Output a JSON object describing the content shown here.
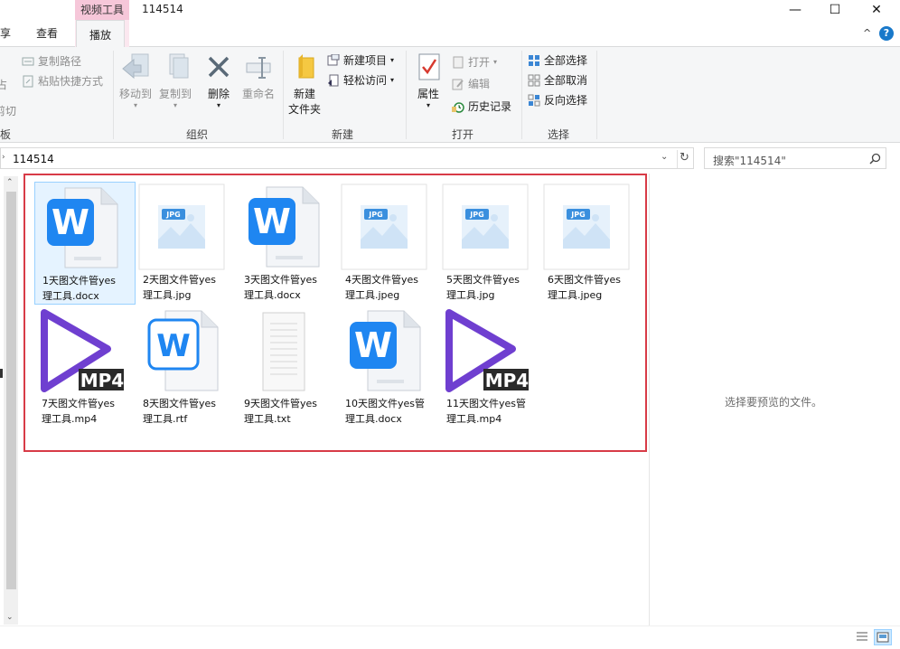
{
  "titlebar": {
    "context_tab": "视频工具",
    "title": "114514",
    "minimize": "—",
    "maximize": "☐",
    "close": "✕"
  },
  "tabs": {
    "share_partial": "享",
    "view": "查看",
    "play": "播放",
    "expand": "^",
    "help": "?"
  },
  "ribbon": {
    "clipboard": {
      "copy_path": "复制路径",
      "paste_shortcut": "粘贴快捷方式",
      "cut_partial": "剪切",
      "paste_partial_top": "占",
      "label_partial": "板"
    },
    "organize": {
      "move_to": "移动到",
      "copy_to": "复制到",
      "delete": "删除",
      "rename": "重命名",
      "label": "组织"
    },
    "new": {
      "new_folder_line1": "新建",
      "new_folder_line2": "文件夹",
      "new_item": "新建项目",
      "easy_access": "轻松访问",
      "label": "新建"
    },
    "open": {
      "properties": "属性",
      "open": "打开",
      "edit": "编辑",
      "history": "历史记录",
      "label": "打开"
    },
    "select": {
      "select_all": "全部选择",
      "select_none": "全部取消",
      "invert": "反向选择",
      "label": "选择"
    }
  },
  "address": {
    "path": "114514",
    "search_placeholder": "搜索\"114514\""
  },
  "files": [
    {
      "line1": "1天图文件管yes",
      "line2": "理工具.docx",
      "type": "word"
    },
    {
      "line1": "2天图文件管yes",
      "line2": "理工具.jpg",
      "type": "jpg"
    },
    {
      "line1": "3天图文件管yes",
      "line2": "理工具.docx",
      "type": "word"
    },
    {
      "line1": "4天图文件管yes",
      "line2": "理工具.jpeg",
      "type": "jpg"
    },
    {
      "line1": "5天图文件管yes",
      "line2": "理工具.jpg",
      "type": "jpg"
    },
    {
      "line1": "6天图文件管yes",
      "line2": "理工具.jpeg",
      "type": "jpg"
    },
    {
      "line1": "7天图文件管yes",
      "line2": "理工具.mp4",
      "type": "mp4"
    },
    {
      "line1": "8天图文件管yes",
      "line2": "理工具.rtf",
      "type": "rtf"
    },
    {
      "line1": "9天图文件管yes",
      "line2": "理工具.txt",
      "type": "txt"
    },
    {
      "line1": "10天图文件yes管",
      "line2": "理工具.docx",
      "type": "word"
    },
    {
      "line1": "11天图文件yes管",
      "line2": "理工具.mp4",
      "type": "mp4"
    }
  ],
  "preview": {
    "message": "选择要预览的文件。"
  },
  "icons": {
    "jpg_badge": "JPG",
    "mp4_badge": "MP4",
    "word_letter": "W"
  },
  "colors": {
    "highlight_border": "#d83b47",
    "word_blue": "#1f86f1",
    "mp4_purple": "#6f3fd0",
    "context_tab": "#f6c7d9"
  }
}
